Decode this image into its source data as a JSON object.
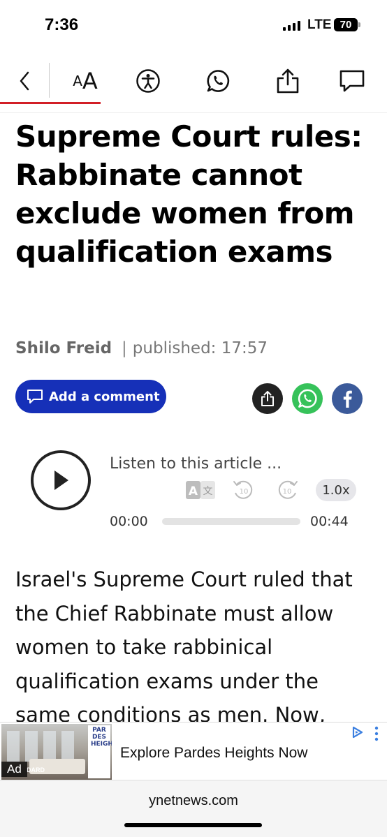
{
  "status_bar": {
    "time": "7:36",
    "network": "LTE",
    "battery": "70"
  },
  "toolbar": {
    "text_size_small": "A",
    "text_size_big": "A",
    "accent_color": "#d21f26"
  },
  "article": {
    "title": "Supreme Court rules: Rabbinate cannot exclude women from qualification exams",
    "author": "Shilo Freid",
    "separator": "|",
    "published": "published: 17:57",
    "comment_button": "Add a comment",
    "body": "Israel's Supreme Court ruled that the Chief Rabbinate must allow women to take rabbinical qualification exams under the same conditions as men. Now,"
  },
  "audio": {
    "listen_label": "Listen to this article ...",
    "translate_badge": "A",
    "translate_glyph": "文",
    "rewind_seconds": "10",
    "forward_seconds": "10",
    "speed": "1.0x",
    "current_time": "00:00",
    "duration": "00:44",
    "progress": 0
  },
  "ad": {
    "label": "Ad",
    "image_text_standard": "DARD",
    "logo_text": "PAR DES HEIGHTS",
    "headline": "Explore Pardes Heights Now"
  },
  "footer": {
    "domain": "ynetnews.com"
  },
  "colors": {
    "comment_button": "#1630b8",
    "whatsapp": "#36c25a",
    "facebook": "#3b5a9a",
    "share_dark": "#222222"
  }
}
